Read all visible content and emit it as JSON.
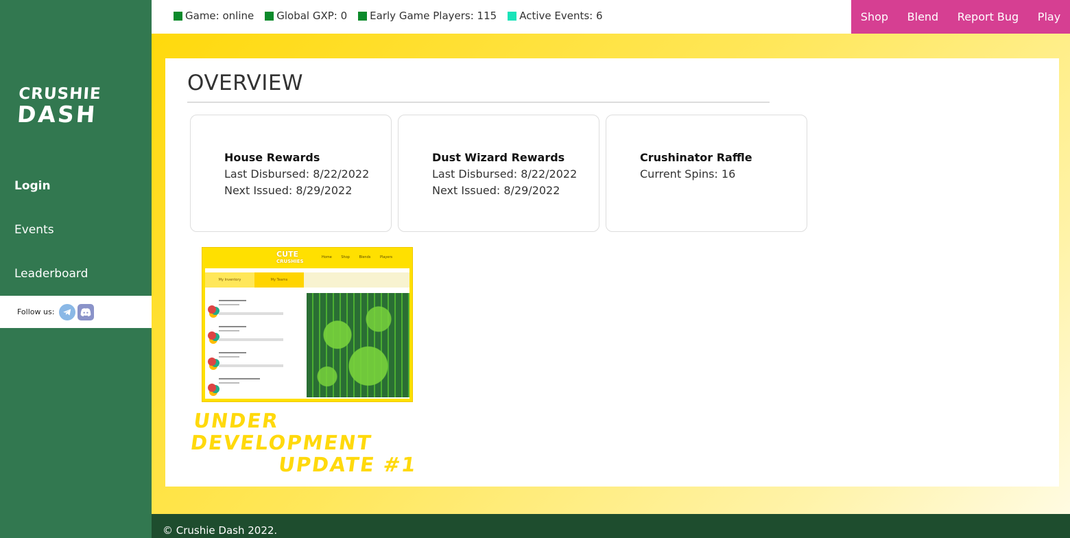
{
  "sidebar": {
    "logo_line1": "CRUSHIE",
    "logo_line2": "DASH",
    "nav": [
      "Login",
      "Events",
      "Leaderboard"
    ],
    "follow_label": "Follow us:",
    "social": [
      "telegram-icon",
      "discord-icon"
    ]
  },
  "topbar": {
    "stats": [
      {
        "label": "Game: online",
        "color": "#0b8a2b"
      },
      {
        "label": "Global GXP: 0",
        "color": "#0b8a2b"
      },
      {
        "label": "Early Game Players: 115",
        "color": "#0b8a2b"
      },
      {
        "label": "Active Events: 6",
        "color": "#19e3b9"
      }
    ],
    "menu": [
      "Shop",
      "Blend",
      "Report Bug",
      "Play"
    ]
  },
  "overview": {
    "title": "OVERVIEW",
    "cards": [
      {
        "title": "House Rewards",
        "line1": "Last Disbursed: 8/22/2022",
        "line2": "Next Issued: 8/29/2022"
      },
      {
        "title": "Dust Wizard Rewards",
        "line1": "Last Disbursed: 8/22/2022",
        "line2": "Next Issued: 8/29/2022"
      },
      {
        "title": "Crushinator Raffle",
        "line1": "Current Spins: 16",
        "line2": ""
      }
    ],
    "thumbnail": {
      "brand_line1": "CUTE",
      "brand_line2": "CRUSHIES",
      "nav_text": "Home Shop Blends Players",
      "tab1": "My Inventory",
      "tab2": "My Teams"
    },
    "dev_line1": "UNDER DEVELOPMENT",
    "dev_line2": "UPDATE #1"
  },
  "footer": {
    "text": "© Crushie Dash 2022."
  },
  "colors": {
    "sidebar": "#327850",
    "accent_pink": "#d63f92",
    "footer": "#1e4d2e",
    "yellow": "#ffd90c"
  }
}
